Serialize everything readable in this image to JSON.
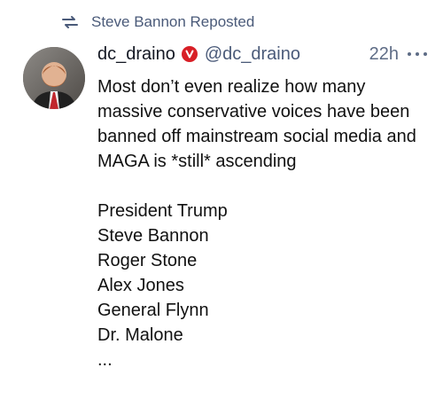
{
  "repost": {
    "icon": "repost-icon",
    "text": "Steve Bannon Reposted"
  },
  "author": {
    "avatar": "avatar",
    "display_name": "dc_draino",
    "verified_icon": "verified-icon",
    "handle": "@dc_draino",
    "time": "22h"
  },
  "post": {
    "text": "Most don’t even realize how many massive conservative voices have been banned off mainstream social media and MAGA is *still* ascending",
    "list": [
      "President Trump",
      "Steve Bannon",
      "Roger Stone",
      "Alex Jones",
      "General Flynn",
      "Dr. Malone",
      "..."
    ]
  },
  "colors": {
    "accent": "#4a5a79",
    "verified": "#d81f26"
  }
}
